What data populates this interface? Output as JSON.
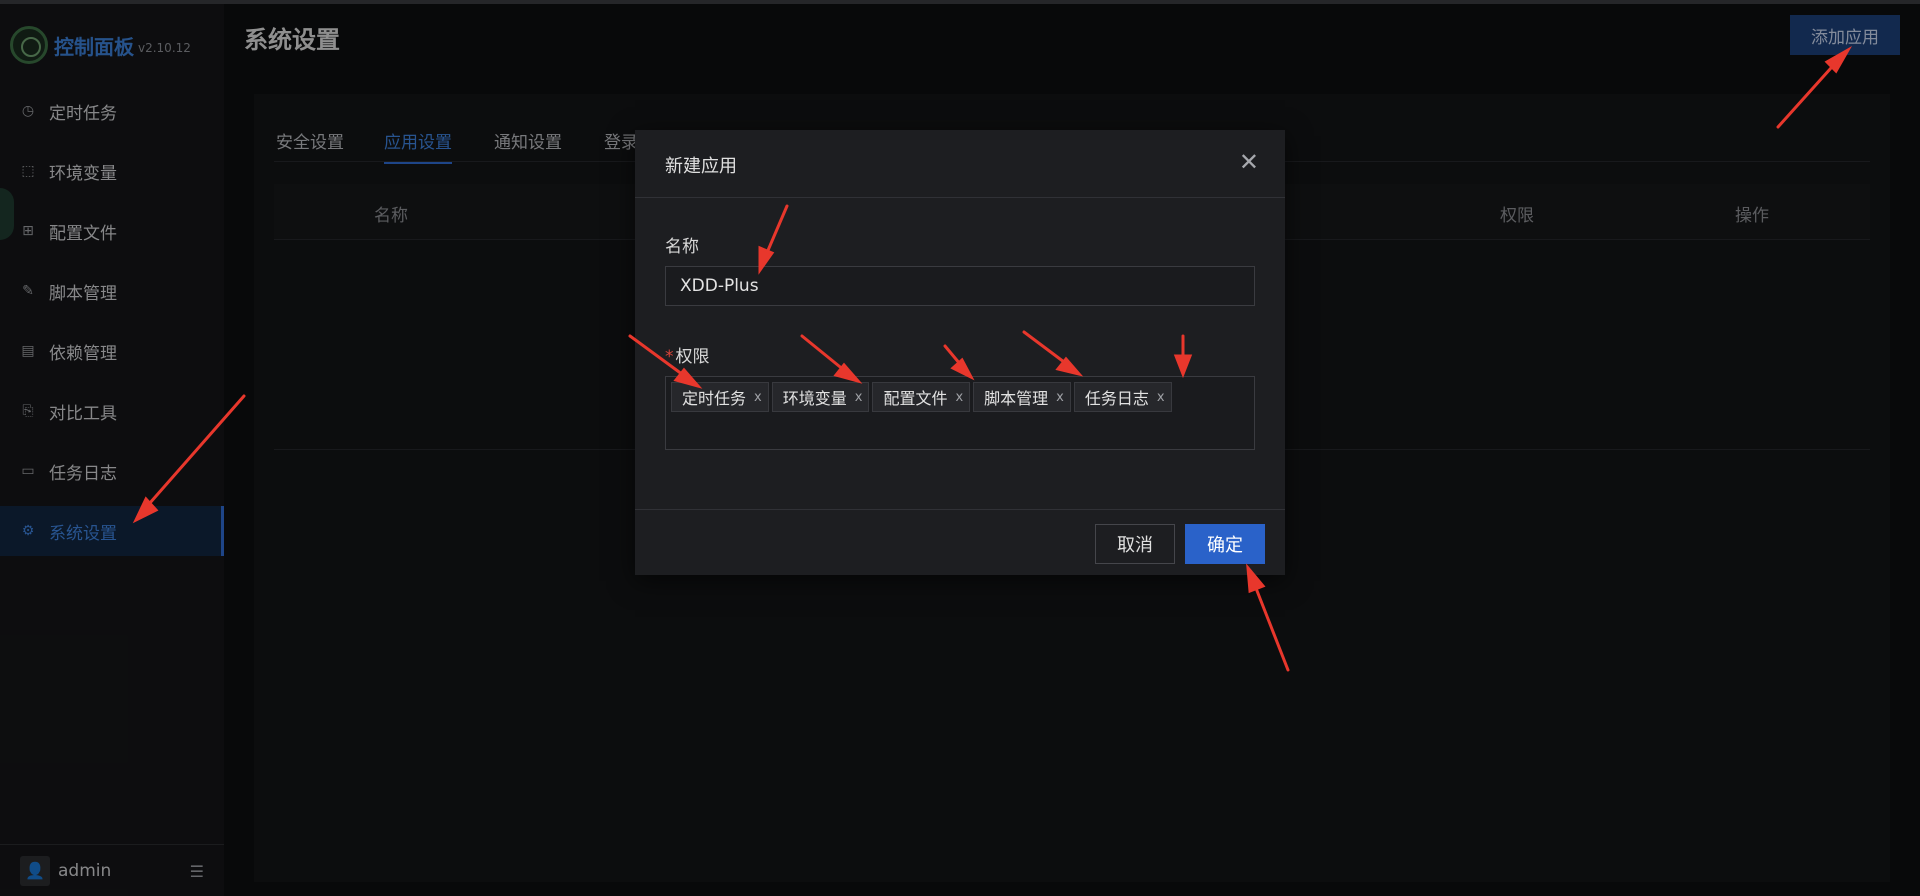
{
  "app": {
    "title": "控制面板",
    "version": "v2.10.12"
  },
  "sidebar": {
    "items": [
      {
        "label": "定时任务",
        "icon": "clock-icon"
      },
      {
        "label": "环境变量",
        "icon": "variable-icon"
      },
      {
        "label": "配置文件",
        "icon": "control-icon"
      },
      {
        "label": "脚本管理",
        "icon": "edit-icon"
      },
      {
        "label": "依赖管理",
        "icon": "book-icon"
      },
      {
        "label": "对比工具",
        "icon": "diff-icon"
      },
      {
        "label": "任务日志",
        "icon": "folder-icon"
      },
      {
        "label": "系统设置",
        "icon": "gear-icon",
        "active": true
      }
    ],
    "user": "admin"
  },
  "header": {
    "title": "系统设置",
    "add_button": "添加应用"
  },
  "tabs": [
    "安全设置",
    "应用设置",
    "通知设置",
    "登录"
  ],
  "table": {
    "columns": [
      "名称",
      "权限",
      "操作"
    ]
  },
  "modal": {
    "title": "新建应用",
    "name_label": "名称",
    "name_value": "XDD-Plus",
    "scope_label": "权限",
    "tags": [
      "定时任务",
      "环境变量",
      "配置文件",
      "脚本管理",
      "任务日志"
    ],
    "cancel": "取消",
    "ok": "确定"
  },
  "colors": {
    "accent": "#2f6bd1",
    "annotation": "#e8372c"
  }
}
